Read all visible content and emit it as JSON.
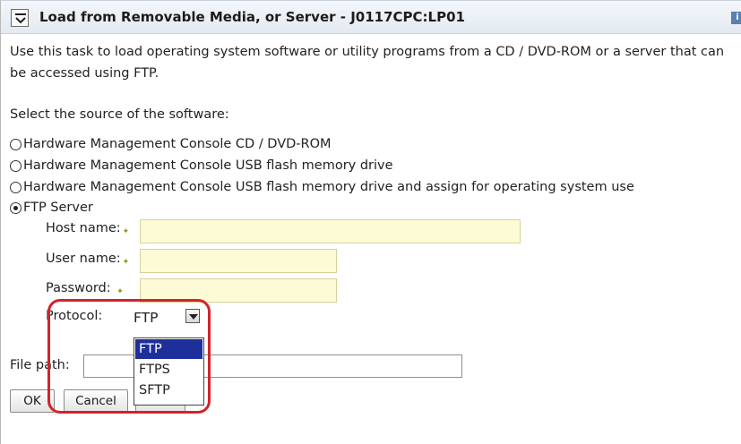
{
  "window": {
    "title": "Load from Removable Media, or Server - J0117CPC:LP01",
    "info_label": "i"
  },
  "description": "Use this task to load operating system software or utility programs from a CD / DVD-ROM or a server that can be accessed using FTP.",
  "source_prompt": "Select the source of the software:",
  "sources": [
    {
      "label": "Hardware Management Console CD / DVD-ROM",
      "selected": false
    },
    {
      "label": "Hardware Management Console USB flash memory drive",
      "selected": false
    },
    {
      "label": "Hardware Management Console USB flash memory drive and assign for operating system use",
      "selected": false
    },
    {
      "label": "FTP Server",
      "selected": true
    }
  ],
  "ftp": {
    "host_label": "Host name:",
    "host_value": "",
    "user_label": "User name:",
    "user_value": "",
    "password_label": "Password:",
    "password_value": "",
    "protocol_label": "Protocol:",
    "protocol_value": "FTP",
    "protocol_options": [
      "FTP",
      "FTPS",
      "SFTP"
    ],
    "required_marker": "✦"
  },
  "file_path_label": "File path:",
  "file_path_value": "",
  "buttons": {
    "ok": "OK",
    "cancel": "Cancel"
  },
  "colors": {
    "required_field_bg": "#fdfbd6",
    "selected_option_bg": "#1d2f9b",
    "callout_border": "#d2232a"
  }
}
